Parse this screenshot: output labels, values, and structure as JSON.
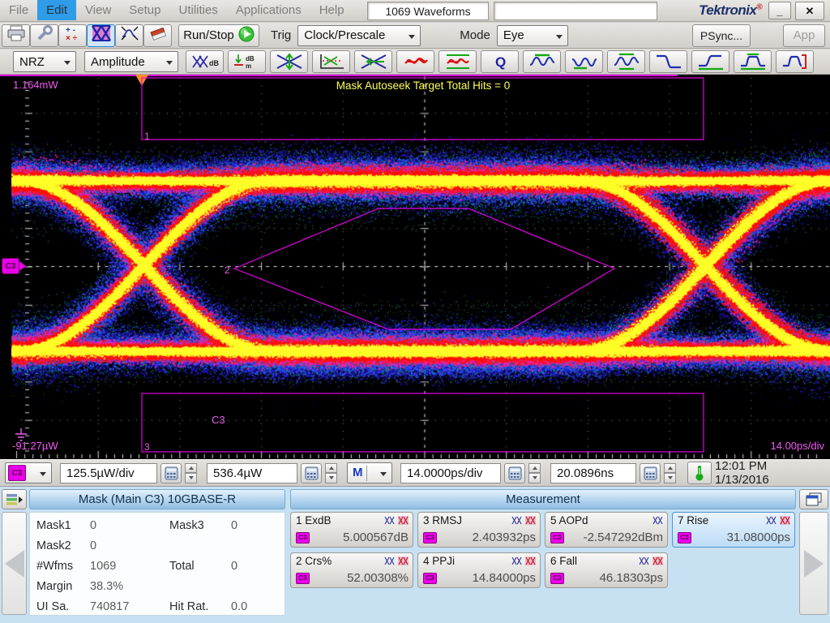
{
  "colors": {
    "accent_magenta": "#e800e8",
    "mask_line": "#e300e3",
    "status_yellow": "#ffff55",
    "selection_blue": "#2f9ce8",
    "eye_core": "#ffff29",
    "eye_mid": "#ff0f00",
    "eye_outer": "#2018b8"
  },
  "menu": {
    "items": [
      "File",
      "Edit",
      "View",
      "Setup",
      "Utilities",
      "Applications",
      "Help"
    ],
    "active_item": "Edit",
    "waveform_count": "1069 Waveforms",
    "brand": "Tektronix"
  },
  "window": {
    "minimize_label": "_",
    "close_label": "✕"
  },
  "toolbar1": {
    "icons": [
      "print",
      "page-setup",
      "math",
      "mask-test",
      "zoom-waveform",
      "erase"
    ],
    "run_stop_label": "Run/Stop",
    "trig_label": "Trig",
    "trig_value": "Clock/Prescale",
    "mode_label": "Mode",
    "mode_value": "Eye",
    "psync_label": "PSync...",
    "app_label": "App"
  },
  "toolbar2": {
    "signal_type": "NRZ",
    "category": "Amplitude",
    "icons": [
      "extinction-ratio-db",
      "avg-optical-power-dbm",
      "eye-height",
      "crossing-percent",
      "eye-width",
      "jitter-rms",
      "jitter-pp",
      "q-factor",
      "high-level",
      "low-level",
      "high-low",
      "fall-time",
      "rise-time",
      "amplitude",
      "time-window"
    ]
  },
  "display": {
    "top_scale": "1.164mW",
    "bottom_scale": "-91.27µW",
    "timebase": "14.00ps/div",
    "mask_status": "Mask Autoseek Target Total Hits = 0",
    "trace_label": "C3",
    "marker_label": "C3",
    "mask1_label": "1",
    "mask2_label": "2",
    "mask3_label": "3"
  },
  "controls": {
    "channel": "C3",
    "vertical_scale": "125.5µW/div",
    "vertical_offset": "536.4µW",
    "timebase_source": "M",
    "horizontal_scale": "14.0000ps/div",
    "horizontal_position": "20.0896ns",
    "datetime": "12:01 PM 1/13/2016"
  },
  "mask_panel": {
    "title": "Mask (Main  C3) 10GBASE-R",
    "rows": [
      {
        "l1": "Mask1",
        "v1": "0",
        "l2": "Mask3",
        "v2": "0"
      },
      {
        "l1": "Mask2",
        "v1": "0",
        "l2": "",
        "v2": ""
      },
      {
        "l1": "#Wfms",
        "v1": "1069",
        "l2": "Total",
        "v2": "0"
      },
      {
        "l1": "Margin",
        "v1": "38.3%",
        "l2": "",
        "v2": ""
      },
      {
        "l1": "UI Sa.",
        "v1": "740817",
        "l2": "Hit Rat.",
        "v2": "0.0"
      }
    ]
  },
  "measurement_panel": {
    "title": "Measurement",
    "source": "C3",
    "cells": [
      {
        "label": "1 ExdB",
        "value": "5.000567dB"
      },
      {
        "label": "2 Crs%",
        "value": "52.00308%"
      },
      {
        "label": "3 RMSJ",
        "value": "2.403932ps"
      },
      {
        "label": "4 PPJi",
        "value": "14.84000ps"
      },
      {
        "label": "5 AOPd",
        "value": "-2.547292dBm"
      },
      {
        "label": "6 Fall",
        "value": "46.18303ps"
      },
      {
        "label": "7 Rise",
        "value": "31.08000ps"
      }
    ]
  }
}
